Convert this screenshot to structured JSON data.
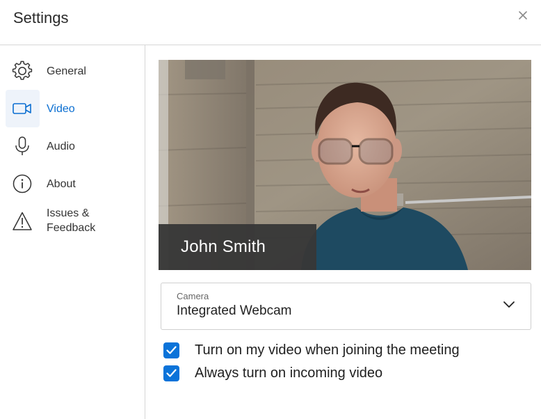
{
  "window": {
    "title": "Settings"
  },
  "sidebar": {
    "items": [
      {
        "label": "General",
        "icon": "gear-icon",
        "active": false
      },
      {
        "label": "Video",
        "icon": "video-camera-icon",
        "active": true
      },
      {
        "label": "Audio",
        "icon": "microphone-icon",
        "active": false
      },
      {
        "label": "About",
        "icon": "info-icon",
        "active": false
      },
      {
        "label": "Issues & Feedback",
        "icon": "warning-icon",
        "active": false
      }
    ]
  },
  "preview": {
    "participant_name": "John Smith"
  },
  "camera": {
    "label": "Camera",
    "selected": "Integrated Webcam"
  },
  "options": [
    {
      "label": "Turn on my video when joining the meeting",
      "checked": true
    },
    {
      "label": "Always turn on incoming video",
      "checked": true
    }
  ],
  "colors": {
    "accent": "#0a73d9",
    "active_background": "#eef3fa",
    "name_tag_background": "#373737"
  }
}
